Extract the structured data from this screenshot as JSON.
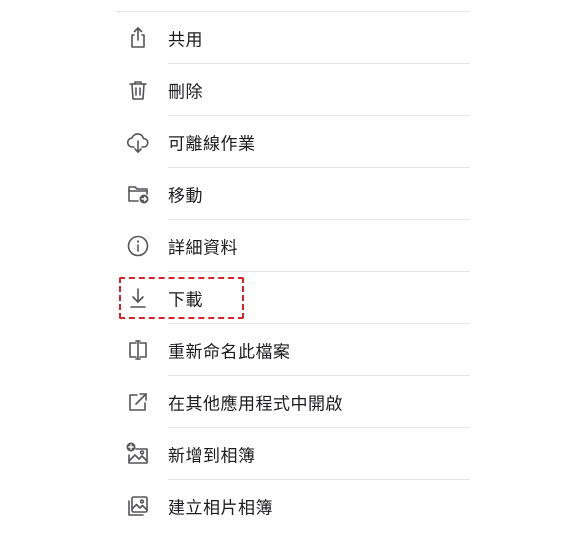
{
  "menu": {
    "items": [
      {
        "label": "共用",
        "icon": "share-icon"
      },
      {
        "label": "刪除",
        "icon": "trash-icon"
      },
      {
        "label": "可離線作業",
        "icon": "cloud-download-icon"
      },
      {
        "label": "移動",
        "icon": "folder-move-icon"
      },
      {
        "label": "詳細資料",
        "icon": "info-icon"
      },
      {
        "label": "下載",
        "icon": "download-icon"
      },
      {
        "label": "重新命名此檔案",
        "icon": "rename-cursor-icon"
      },
      {
        "label": "在其他應用程式中開啟",
        "icon": "open-external-icon"
      },
      {
        "label": "新增到相簿",
        "icon": "add-to-album-icon"
      },
      {
        "label": "建立相片相簿",
        "icon": "create-photo-album-icon"
      }
    ]
  },
  "highlight": {
    "target": "download",
    "color": "#d9232a",
    "style": "dashed"
  }
}
